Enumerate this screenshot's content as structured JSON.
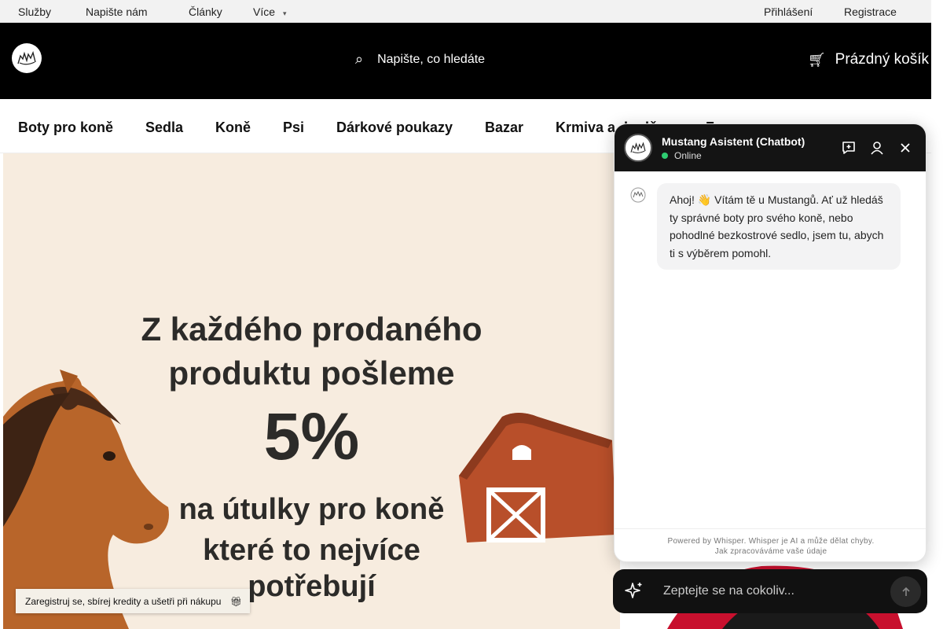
{
  "topbar": {
    "links": [
      "Služby",
      "Napište nám",
      "Články",
      "Více"
    ],
    "more_caret_icon": "chevron-down-icon",
    "login": "Přihlášení",
    "register": "Registrace"
  },
  "header": {
    "search_placeholder": "Napište, co hledáte",
    "search_icon": "search-icon",
    "cart_icon": "cart-icon",
    "cart_label": "Prázdný košík"
  },
  "nav": {
    "items": [
      "Boty pro koně",
      "Sedla",
      "Koně",
      "Psi",
      "Dárkové poukazy",
      "Bazar",
      "Krmiva a doplň",
      "Zn"
    ]
  },
  "banner": {
    "lines": [
      "Z každého prodaného",
      "produktu pošleme",
      "5%",
      "na útulky pro koně",
      "které to nejvíce",
      "potřebují"
    ],
    "colors": {
      "background": "#f7ecdf",
      "horse": "#b8652a",
      "barn": "#b84f2a"
    }
  },
  "promo": {
    "text": "Zaregistruj se, sbírej kredity a ušetři při nákupu",
    "icon": "gift-icon"
  },
  "chat": {
    "title": "Mustang Asistent (Chatbot)",
    "status": "Online",
    "status_color": "#2ecc71",
    "header_icons": [
      "new-chat-icon",
      "user-icon",
      "close-icon"
    ],
    "welcome_message": "Ahoj! 👋 Vítám tě u Mustangů. Ať už hledáš ty správné boty pro svého koně, nebo pohodlné bezkostrové sedlo, jsem tu, abych ti s výběrem pomohl.",
    "footer_line1": "Powered by Whisper. Whisper je AI a může dělat chyby.",
    "footer_line2": "Jak zpracováváme vaše údaje",
    "input_placeholder": "Zeptejte se na cokoliv...",
    "input_icons": [
      "sparkle-icon",
      "send-arrow-icon"
    ]
  }
}
